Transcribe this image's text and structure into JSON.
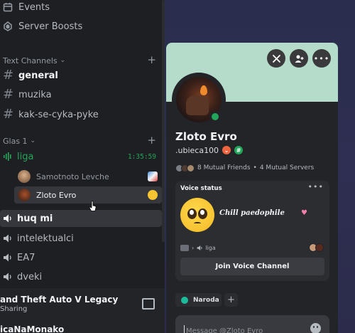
{
  "sidebar": {
    "items": [
      {
        "label": "Events",
        "icon": "calendar-icon"
      },
      {
        "label": "Server Boosts",
        "icon": "boost-icon"
      }
    ],
    "text_category": "Text Channels",
    "text_channels": [
      "general",
      "muzika",
      "kak-se-cyka-pyke"
    ],
    "voice_category": "Glas 1",
    "voice_channel": {
      "name": "liga",
      "timer": "1:35:59"
    },
    "voice_users": [
      "Samotnoto Levche",
      "Zloto Evro"
    ],
    "other_voice_channels": [
      "huq mi",
      "intelektualci",
      "EA7",
      "dveki"
    ],
    "activity": {
      "title": "and Theft Auto V Legacy",
      "subtitle": "Sharing"
    },
    "user": {
      "name": "icaNaMonako"
    }
  },
  "profile": {
    "display_name": "Zloto Evro",
    "username": ".ubieca100",
    "mutual_friends": "8 Mutual Friends",
    "separator": "•",
    "mutual_servers": "4 Mutual Servers",
    "voice_card": {
      "title": "Voice status",
      "more": "•••",
      "status_text": "Chill paedophile",
      "heart": "♥",
      "channel": "liga",
      "join_label": "Join Voice Channel"
    },
    "role": "Naroda",
    "add_role": "+",
    "message_placeholder": "Message @Zloto Evro"
  },
  "colors": {
    "banner": "#b5dccb",
    "online": "#23a55a",
    "voice_active": "#23a55a",
    "role": "#1abc9c",
    "sidebar_bg": "#1e1f22",
    "popup_bg": "#232428"
  }
}
